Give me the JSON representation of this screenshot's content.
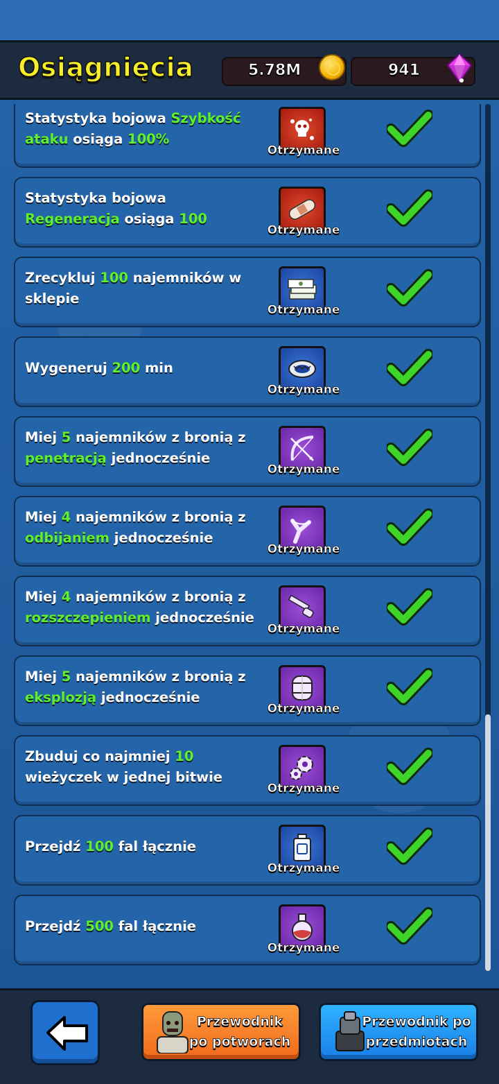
{
  "header": {
    "title": "Osiągnięcia",
    "coins": "5.78M",
    "gems": "941"
  },
  "status_label": "Otrzymane",
  "achievements": [
    {
      "parts": [
        "Statystyka bojowa ",
        "Szybkość ataku",
        " osiąga ",
        "100%"
      ],
      "icon": "skull-splat-icon",
      "color": "red"
    },
    {
      "parts": [
        "Statystyka bojowa ",
        "Regeneracja",
        " osiąga ",
        "100"
      ],
      "icon": "bandage-icon",
      "color": "red"
    },
    {
      "parts": [
        "Zrecykluj ",
        "100",
        " najemników w sklepie"
      ],
      "icon": "cash-stack-icon",
      "color": "blue"
    },
    {
      "parts": [
        "Wygeneruj ",
        "200",
        " min"
      ],
      "icon": "bear-trap-icon",
      "color": "blue"
    },
    {
      "parts": [
        "Miej ",
        "5",
        " najemników z bronią z ",
        "penetracją",
        " jednocześnie"
      ],
      "icon": "bow-icon",
      "color": "purple"
    },
    {
      "parts": [
        "Miej ",
        "4",
        " najemników z bronią z ",
        "odbijaniem",
        " jednocześnie"
      ],
      "icon": "slingshot-icon",
      "color": "purple"
    },
    {
      "parts": [
        "Miej ",
        "4",
        " najemników z bronią z ",
        "rozszczepieniem",
        " jednocześnie"
      ],
      "icon": "shotgun-icon",
      "color": "purple"
    },
    {
      "parts": [
        "Miej ",
        "5",
        " najemników z bronią z ",
        "eksplozją",
        " jednocześnie"
      ],
      "icon": "barrel-icon",
      "color": "purple"
    },
    {
      "parts": [
        "Zbuduj co najmniej ",
        "10",
        " wieżyczek w jednej bitwie"
      ],
      "icon": "gears-icon",
      "color": "purple"
    },
    {
      "parts": [
        "Przejdź ",
        "100",
        " fal łącznie"
      ],
      "icon": "fuel-can-icon",
      "color": "blue"
    },
    {
      "parts": [
        "Przejdź ",
        "500",
        " fal łącznie"
      ],
      "icon": "potion-flask-icon",
      "color": "purple"
    }
  ],
  "footer": {
    "monster_guide": "Przewodnik po potworach",
    "item_guide": "Przewodnik po przedmiotach"
  },
  "colors": {
    "title": "#f7ee2a",
    "highlight": "#5ef02a",
    "row_bg": "#2465a9",
    "header_bg": "#1c2b40"
  }
}
